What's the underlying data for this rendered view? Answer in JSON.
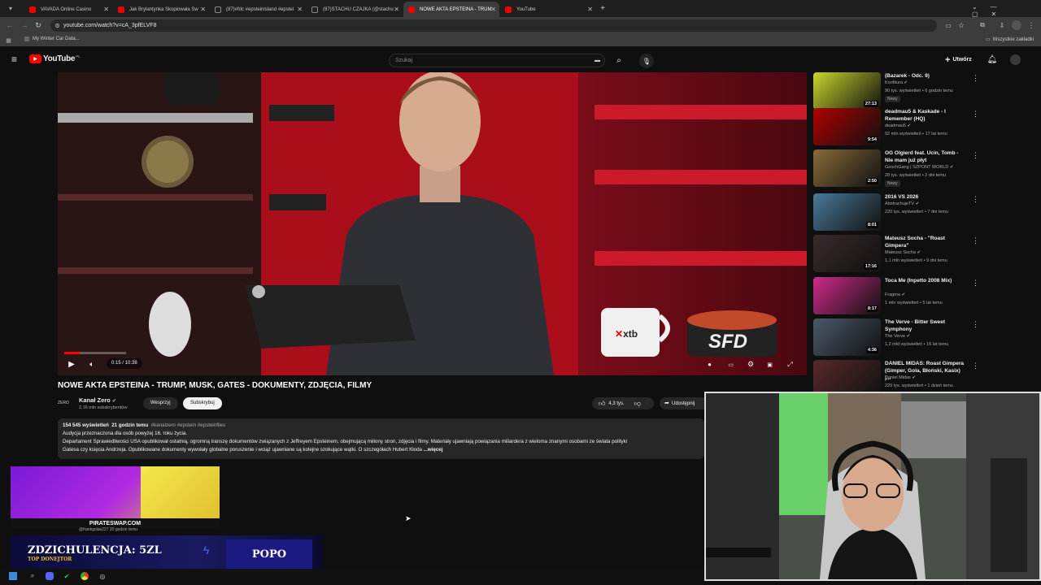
{
  "browser": {
    "tabs": [
      {
        "label": "VAVADA Online Casino",
        "active": false
      },
      {
        "label": "Jak Brylantynka Skopiowała Sw",
        "active": false
      },
      {
        "label": "(87)#fdc #epsteinisland #epstei",
        "active": false
      },
      {
        "label": "(87)STACHU CZAJKA (@stachu",
        "active": false
      },
      {
        "label": "NOWE AKTA EPSTEINA - TRUM",
        "active": true
      },
      {
        "label": "YouTube",
        "active": false
      }
    ],
    "url": "youtube.com/watch?v=cA_3pfELVF8",
    "bookmark": "My Winter Car Data...",
    "all_bookmarks": "Wszystkie zakładki"
  },
  "yt_header": {
    "logo": "YouTube",
    "logo_country": "PL",
    "search_placeholder": "Szukaj",
    "create_label": "Utwórz"
  },
  "player": {
    "time": "0:15 / 10:38",
    "progress_fraction": 0.024,
    "overlay_brand": "xtb"
  },
  "video": {
    "title": "NOWE AKTA EPSTEINA - TRUMP, MUSK, GATES - DOKUMENTY, ZDJĘCIA, FILMY",
    "channel": "Kanał Zero",
    "subscribers": "2,16 mln subskrybentów",
    "support_label": "Wesprzyj",
    "subscribe_label": "Subskrybuj",
    "likes": "4,3 tys.",
    "share_label": "Udostępnij"
  },
  "description": {
    "views": "154 545 wyświetleń",
    "age": "21 godzin temu",
    "tags": "#kanalzero #epstein #epsteinfiles",
    "line1": "Audycja przeznaczona dla osób powyżej 16. roku życia.",
    "line2": "Departament Sprawiedliwości USA opublikował ostatnią, ogromną transzę dokumentów związanych z Jeffreyem Epsteinem, obejmującą miliony stron, zdjęcia i filmy. Materiały ujawniają powiązania miliardera z wieloma znanymi osobami ze świata polityki",
    "line3": "Gatesa czy księcia Andrzeja. Opublikowane dokumenty wywołały globalne poruszenie i wciąż ujawniane są kolejne szokujące wątki. O szczegółach Hubert Kłoda",
    "more": "...więcej"
  },
  "recommendations": [
    {
      "title": "(Bazarek - Odc. 9)",
      "channel": "Konfitura",
      "meta": "90 tys. wyświetleń • 6 godzin temu",
      "duration": "27:13",
      "new": "Nowy",
      "color": "#c8d62a"
    },
    {
      "title": "deadmau5 & Kaskade - I Remember (HQ)",
      "channel": "deadmau5",
      "meta": "92 mln wyświetleń • 17 lat temu",
      "duration": "9:54",
      "new": "",
      "color": "#b00000"
    },
    {
      "title": "OG Olgierd feat. Ucin, Tomb - Nie mam już płyt",
      "channel": "GoochGang | SZPONT WORLD",
      "meta": "28 tys. wyświetleń • 2 dni temu",
      "duration": "2:50",
      "new": "Nowy",
      "color": "#8a6a3a"
    },
    {
      "title": "2016 VS 2026",
      "channel": "AbstrachujeTV",
      "meta": "220 tys. wyświetleń • 7 dni temu",
      "duration": "8:01",
      "new": "",
      "color": "#4a7a9a"
    },
    {
      "title": "Mateusz Socha - \"Roast Gimpera\"",
      "channel": "Mateusz Socha",
      "meta": "1,1 mln wyświetleń • 9 dni temu",
      "duration": "17:16",
      "new": "",
      "color": "#3a2a2a"
    },
    {
      "title": "Toca Me (Inpetto 2008 Mix)",
      "channel": "Fragma",
      "meta": "1 mln wyświetleń • 5 lat temu",
      "duration": "8:17",
      "new": "",
      "color": "#d02a8a"
    },
    {
      "title": "The Verve - Bitter Sweet Symphony",
      "channel": "The Verve",
      "meta": "1,2 mld wyświetleń • 16 lat temu",
      "duration": "4:36",
      "new": "",
      "color": "#4a5a6a"
    },
    {
      "title": "DANIEL MIDAS: Roast Gimpera (Gimper, Gola, Błoński, Kasix) |...",
      "channel": "Daniel Midas",
      "meta": "229 tys. wyświetleń • 1 dzień temu",
      "duration": "",
      "new": "",
      "color": "#5a2a2a"
    }
  ],
  "overlay": {
    "ad_domain": "PIRATESWAP.COM",
    "comment_user": "@frankgolas227",
    "comment_time": "20 godzin temu",
    "donation_label": "ZDZICHULENCJA: 5ZL",
    "donation_sub": "TOP DONEJTOR",
    "donation_name": "POPO"
  },
  "colors": {
    "yt_red": "#ff0000",
    "bg": "#0f0f0f",
    "progress": "#ff0000"
  }
}
